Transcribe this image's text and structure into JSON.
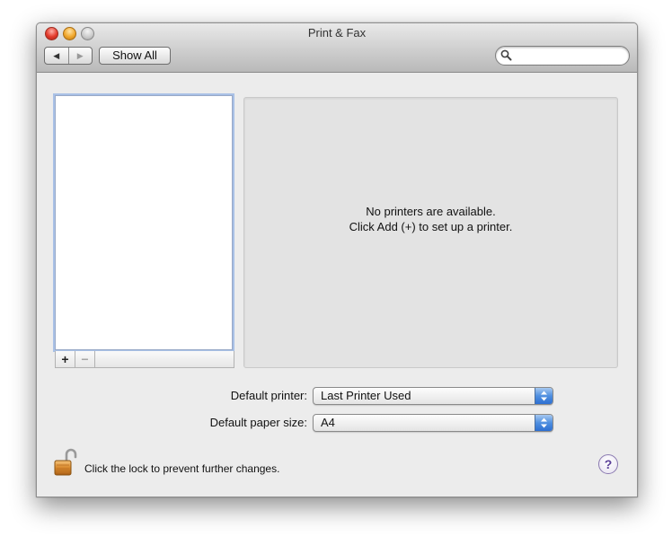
{
  "window": {
    "title": "Print & Fax"
  },
  "toolbar": {
    "back_icon": "triangle-left-icon",
    "forward_icon": "triangle-right-icon",
    "show_all_label": "Show All",
    "search_placeholder": "",
    "search_value": ""
  },
  "printer_list": {
    "items": [],
    "add_label": "+",
    "remove_label": "−"
  },
  "detail": {
    "line1": "No printers are available.",
    "line2": "Click Add (+) to set up a printer."
  },
  "defaults": {
    "printer_label": "Default printer:",
    "printer_value": "Last Printer Used",
    "paper_label": "Default paper size:",
    "paper_value": "A4"
  },
  "footer": {
    "lock_text": "Click the lock to prevent further changes.",
    "help_label": "?"
  },
  "colors": {
    "window_bg": "#ececec",
    "popup_accent": "#4f8fe0",
    "help_accent": "#5a3e98"
  }
}
